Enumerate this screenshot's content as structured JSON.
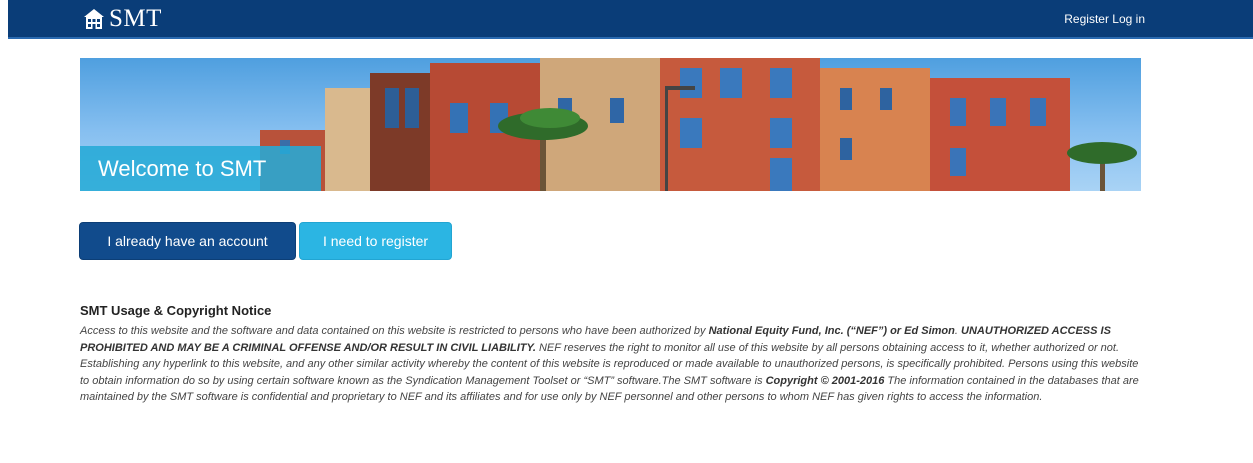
{
  "navbar": {
    "brand": "SMT",
    "register_label": "Register",
    "login_label": "Log in"
  },
  "hero": {
    "title": "Welcome to SMT"
  },
  "buttons": {
    "have_account": "I already have an account",
    "need_register": "I need to register"
  },
  "notice": {
    "title": "SMT Usage & Copyright Notice",
    "p1": "Access to this website and the software and data contained on this website is restricted to persons who have been authorized by ",
    "org": "National Equity Fund, Inc. (“NEF”) or Ed Simon",
    "p2": ". ",
    "warning": "UNAUTHORIZED ACCESS IS PROHIBITED AND MAY BE A CRIMINAL OFFENSE AND/OR RESULT IN CIVIL LIABILITY.",
    "p3": " NEF reserves the right to monitor all use of this website by all persons obtaining access to it, whether authorized or not. Establishing any hyperlink to this website, and any other similar activity whereby the content of this website is reproduced or made available to unauthorized persons, is specifically prohibited. Persons using this website to obtain information do so by using certain software known as the Syndication Management Toolset or “SMT” software.The SMT software is ",
    "copyright": "Copyright © 2001-2016",
    "p4": " The information contained in the databases that are maintained by the SMT software is confidential and proprietary to NEF and its affiliates and for use only by NEF personnel and other persons to whom NEF has given rights to access the information."
  },
  "colors": {
    "navbar_bg": "#0a3d78",
    "primary_button": "#114b8c",
    "info_button": "#2bb5e3",
    "hero_caption": "#26aad6"
  }
}
